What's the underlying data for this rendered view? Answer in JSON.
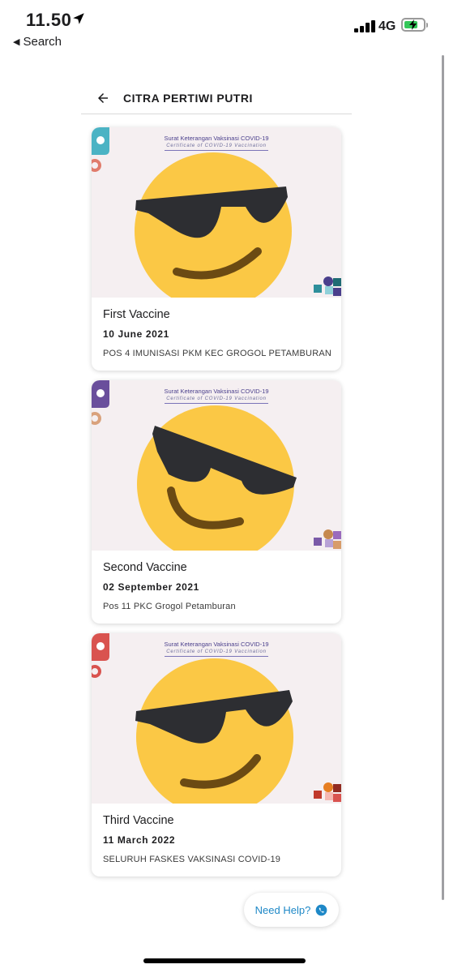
{
  "status_bar": {
    "time": "11.50",
    "back_app": "Search",
    "network": "4G"
  },
  "header": {
    "title": "CITRA PERTIWI PUTRI"
  },
  "certificate": {
    "title": "Surat Keterangan Vaksinasi COVID-19",
    "subtitle": "Certificate of COVID-19 Vaccination"
  },
  "cards": [
    {
      "name": "First Vaccine",
      "date": "10 June 2021",
      "place": "POS 4 IMUNISASI PKM KEC GROGOL PETAMBURAN"
    },
    {
      "name": "Second Vaccine",
      "date": "02 September 2021",
      "place": "Pos 11 PKC Grogol Petamburan"
    },
    {
      "name": "Third Vaccine",
      "date": "11 March 2022",
      "place": "SELURUH FASKES VAKSINASI COVID-19"
    }
  ],
  "help": {
    "label": "Need Help?"
  },
  "icons": {
    "back": "arrow-left-icon",
    "location": "location-arrow-icon",
    "whatsapp": "whatsapp-icon",
    "censor": "sunglasses-emoji-icon"
  },
  "colors": {
    "help_text": "#1e88c7",
    "battery": "#34c759"
  }
}
